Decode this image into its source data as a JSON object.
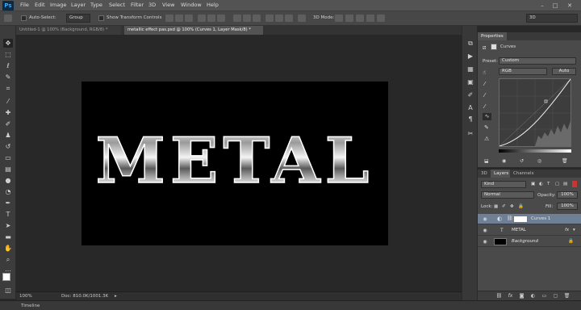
{
  "app": {
    "logo": "Ps",
    "menu": [
      "File",
      "Edit",
      "Image",
      "Layer",
      "Type",
      "Select",
      "Filter",
      "3D",
      "View",
      "Window",
      "Help"
    ],
    "workspace_selector": "3D"
  },
  "options_bar": {
    "auto_select_label": "Auto-Select:",
    "auto_select_value": "Group",
    "show_transform_label": "Show Transform Controls",
    "mode_3d_label": "3D Mode:"
  },
  "document_tabs": [
    {
      "label": "Untitled-1 @ 100% (Background, RGB/8) *",
      "active": false
    },
    {
      "label": "metallic effect pas.psd @ 100% (Curves 1, Layer Mask/8) *",
      "active": true
    }
  ],
  "canvas": {
    "text": "METAL",
    "background": "#000000"
  },
  "status_bar": {
    "zoom": "100%",
    "doc_info": "Doc: 810.0K/1001.3K"
  },
  "timeline": {
    "label": "Timeline"
  },
  "properties": {
    "tab_label": "Properties",
    "adjustment_label": "Curves",
    "preset_label": "Preset:",
    "preset_value": "Custom",
    "channel_value": "RGB",
    "auto_button": "Auto"
  },
  "layers": {
    "tabs": [
      "3D",
      "Layers",
      "Channels"
    ],
    "kind_filter": "Kind",
    "blend_mode": "Normal",
    "opacity_label": "Opacity:",
    "opacity_value": "100%",
    "lock_label": "Lock:",
    "fill_label": "Fill:",
    "fill_value": "100%",
    "items": [
      {
        "name": "Curves 1",
        "type": "adjustment",
        "selected": true
      },
      {
        "name": "METAL",
        "type": "text",
        "selected": false
      },
      {
        "name": "Background",
        "type": "pixel",
        "selected": false
      }
    ]
  },
  "colors": {
    "menubar": "#535353",
    "panel": "#4a4a4a",
    "workspace": "#282828",
    "selected_layer": "#6f7f96"
  }
}
